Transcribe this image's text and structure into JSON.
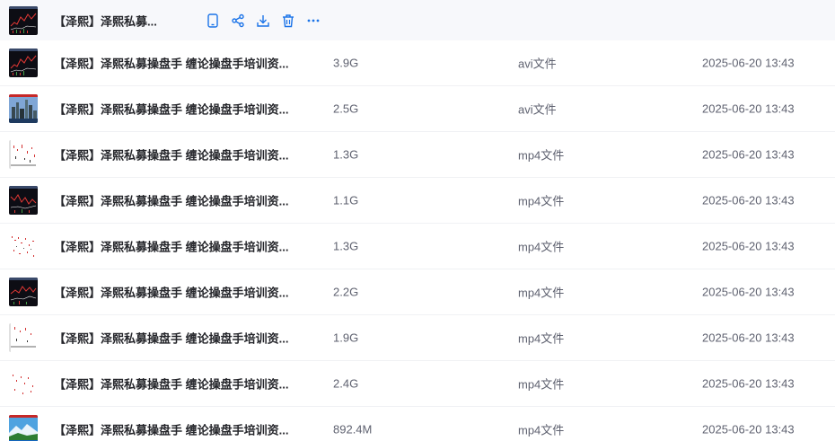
{
  "files": [
    {
      "name": "【泽熙】泽熙私募...",
      "size": "",
      "type": "",
      "date": "",
      "thumb": "chart-dark"
    },
    {
      "name": "【泽熙】泽熙私募操盘手 缠论操盘手培训资...",
      "size": "3.9G",
      "type": "avi文件",
      "date": "2025-06-20 13:43",
      "thumb": "chart-dark"
    },
    {
      "name": "【泽熙】泽熙私募操盘手 缠论操盘手培训资...",
      "size": "2.5G",
      "type": "avi文件",
      "date": "2025-06-20 13:43",
      "thumb": "city"
    },
    {
      "name": "【泽熙】泽熙私募操盘手 缠论操盘手培训资...",
      "size": "1.3G",
      "type": "mp4文件",
      "date": "2025-06-20 13:43",
      "thumb": "chart-white"
    },
    {
      "name": "【泽熙】泽熙私募操盘手 缠论操盘手培训资...",
      "size": "1.1G",
      "type": "mp4文件",
      "date": "2025-06-20 13:43",
      "thumb": "chart-dark"
    },
    {
      "name": "【泽熙】泽熙私募操盘手 缠论操盘手培训资...",
      "size": "1.3G",
      "type": "mp4文件",
      "date": "2025-06-20 13:43",
      "thumb": "chart-white"
    },
    {
      "name": "【泽熙】泽熙私募操盘手 缠论操盘手培训资...",
      "size": "2.2G",
      "type": "mp4文件",
      "date": "2025-06-20 13:43",
      "thumb": "chart-dark"
    },
    {
      "name": "【泽熙】泽熙私募操盘手 缠论操盘手培训资...",
      "size": "1.9G",
      "type": "mp4文件",
      "date": "2025-06-20 13:43",
      "thumb": "chart-white"
    },
    {
      "name": "【泽熙】泽熙私募操盘手 缠论操盘手培训资...",
      "size": "2.4G",
      "type": "mp4文件",
      "date": "2025-06-20 13:43",
      "thumb": "chart-white"
    },
    {
      "name": "【泽熙】泽熙私募操盘手 缠论操盘手培训资...",
      "size": "892.4M",
      "type": "mp4文件",
      "date": "2025-06-20 13:43",
      "thumb": "landscape"
    }
  ],
  "hover_actions": [
    {
      "icon": "phone-icon"
    },
    {
      "icon": "share-icon"
    },
    {
      "icon": "download-icon"
    },
    {
      "icon": "delete-icon"
    },
    {
      "icon": "more-icon"
    }
  ],
  "colors": {
    "accent": "#1a73e8",
    "hover_row": "#f7f8fb"
  }
}
